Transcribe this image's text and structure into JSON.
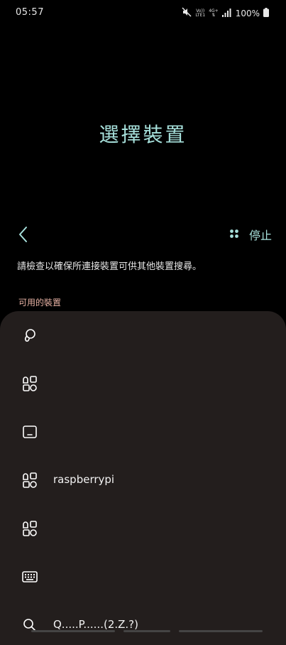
{
  "status": {
    "time": "05:57",
    "volte_top": "Vo))",
    "volte_bottom": "LTE1",
    "net_top": "4G+",
    "net_bottom": "⇅",
    "battery": "100%"
  },
  "page": {
    "title": "選擇裝置",
    "stop_label": "停止",
    "description": "請檢查以確保所連接裝置可供其他裝置搜尋。",
    "section_label": "可用的裝置"
  },
  "devices": [
    {
      "icon": "earbuds-icon",
      "name": ""
    },
    {
      "icon": "shapes-icon",
      "name": ""
    },
    {
      "icon": "tablet-icon",
      "name": ""
    },
    {
      "icon": "shapes-icon",
      "name": "raspberrypi"
    },
    {
      "icon": "shapes-icon",
      "name": ""
    },
    {
      "icon": "keyboard-icon",
      "name": ""
    },
    {
      "icon": "search-icon",
      "name": "Q.....P......(2.Z.?)"
    }
  ],
  "colors": {
    "background": "#000000",
    "panel": "#231e1d",
    "accent": "#a7e1dc",
    "section_label": "#e7b2a4",
    "text": "#ffffff"
  }
}
